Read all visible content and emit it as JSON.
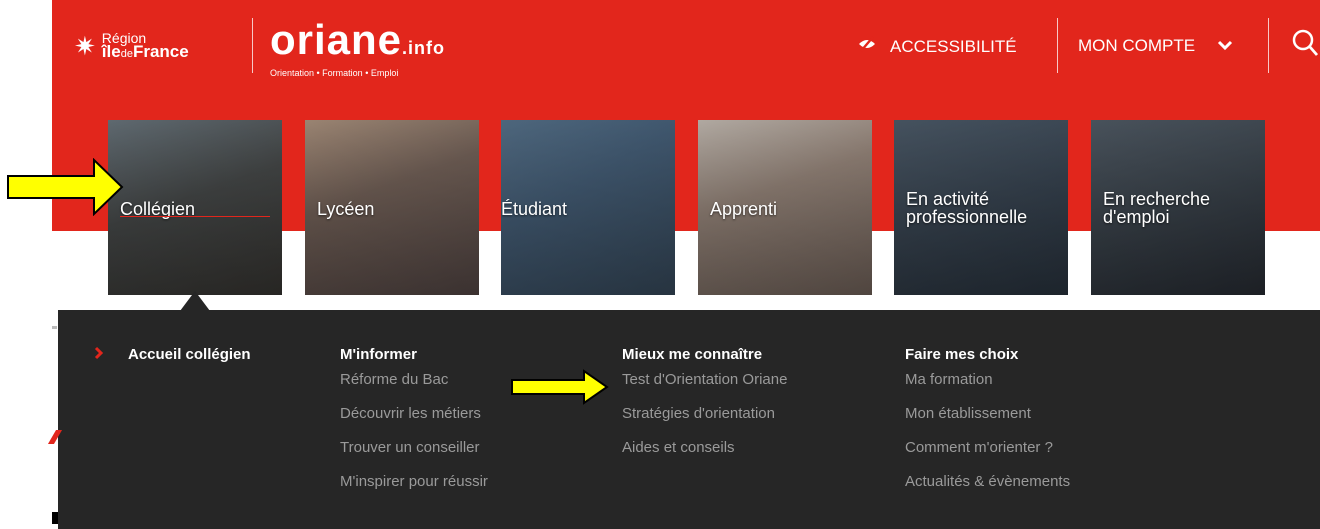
{
  "header": {
    "region_line1": "Région",
    "region_line2a": "île",
    "region_line2b": "de",
    "region_line2c": "France",
    "brand": "oriane",
    "brand_suffix": ".info",
    "tagline": "Orientation • Formation • Emploi",
    "accessibility": "ACCESSIBILITÉ",
    "account": "MON COMPTE"
  },
  "profiles": [
    {
      "label": "Collégien"
    },
    {
      "label": "Lycéen"
    },
    {
      "label": "Étudiant"
    },
    {
      "label": "Apprenti"
    },
    {
      "label": "En activité professionnelle"
    },
    {
      "label": "En recherche d'emploi"
    }
  ],
  "menu": {
    "home": "Accueil collégien",
    "columns": [
      {
        "title": "M'informer",
        "items": [
          "Réforme du Bac",
          "Découvrir les métiers",
          "Trouver un conseiller",
          "M'inspirer pour réussir"
        ]
      },
      {
        "title": "Mieux me connaître",
        "items": [
          "Test d'Orientation Oriane",
          "Stratégies d'orientation",
          "Aides et conseils"
        ]
      },
      {
        "title": "Faire mes choix",
        "items": [
          "Ma formation",
          "Mon établissement",
          "Comment m'orienter ?",
          "Actualités & évènements"
        ]
      }
    ]
  },
  "colors": {
    "brand_red": "#e2261c",
    "menu_bg": "#262626",
    "annotation_arrow": "#ffff00"
  },
  "icons": [
    "region-star-icon",
    "accessibility-eye-icon",
    "chevron-down-icon",
    "search-icon",
    "chevron-right-icon",
    "yellow-arrow-icon"
  ]
}
